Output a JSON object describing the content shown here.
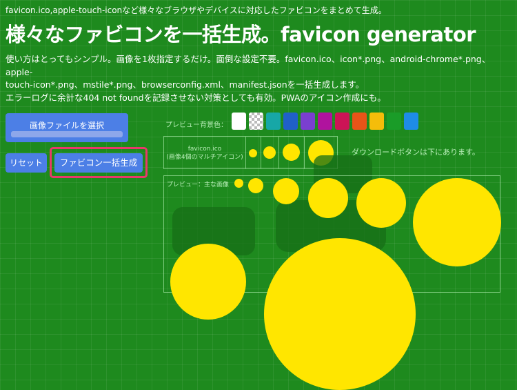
{
  "header": {
    "tagline": "favicon.ico,apple-touch-iconなど様々なブラウザやデバイスに対応したファビコンをまとめて生成。",
    "title": "様々なファビコンを一括生成。favicon generator",
    "description_line1": "使い方はとってもシンプル。画像を1枚指定するだけ。面倒な設定不要。favicon.ico、icon*.png、android-chrome*.png、apple-",
    "description_line2": "touch-icon*.png、mstile*.png、browserconfig.xml、manifest.jsonを一括生成します。",
    "description_line3": "エラーログに余計な404 not foundを記録させない対策としても有効。PWAのアイコン作成にも。"
  },
  "controls": {
    "select_image_label": "画像ファイルを選択",
    "reset_label": "リセット",
    "generate_label": "ファビコン一括生成"
  },
  "preview": {
    "background_label": "プレビュー背景色：",
    "swatches": [
      "#ffffff",
      "checker",
      "#17a7a7",
      "#2060c8",
      "#7a3fd0",
      "#b0139e",
      "#cc1456",
      "#e85418",
      "#f5bd0a",
      "#1a9c28",
      "#1e8ce6"
    ],
    "favicon_label_line1": "favicon.ico",
    "favicon_label_line2": "(画像4個のマルチアイコン)",
    "download_note": "ダウンロードボタンは下にあります。",
    "main_label": "プレビュー：主な画像",
    "icon_color": "#ffe600"
  }
}
